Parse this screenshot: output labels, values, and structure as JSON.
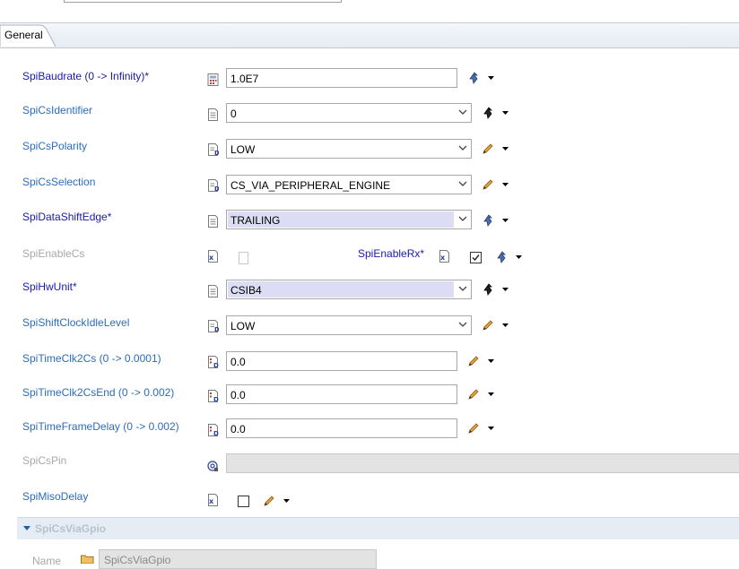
{
  "tab": {
    "label": "General"
  },
  "rows": {
    "baudrate": {
      "label": "SpiBaudrate (0 -> Infinity)*",
      "value": "1.0E7"
    },
    "cs_identifier": {
      "label": "SpiCsIdentifier",
      "value": "0"
    },
    "cs_polarity": {
      "label": "SpiCsPolarity",
      "value": "LOW"
    },
    "cs_selection": {
      "label": "SpiCsSelection",
      "value": "CS_VIA_PERIPHERAL_ENGINE"
    },
    "data_shift_edge": {
      "label": "SpiDataShiftEdge*",
      "value": "TRAILING"
    },
    "enable_cs": {
      "label": "SpiEnableCs",
      "checked": false
    },
    "enable_rx": {
      "label": "SpiEnableRx*",
      "checked": true
    },
    "hw_unit": {
      "label": "SpiHwUnit*",
      "value": "CSIB4"
    },
    "shift_clock_idle": {
      "label": "SpiShiftClockIdleLevel",
      "value": "LOW"
    },
    "time_clk2cs": {
      "label": "SpiTimeClk2Cs (0 -> 0.0001)",
      "value": "0.0"
    },
    "time_clk2cs_end": {
      "label": "SpiTimeClk2CsEnd (0 -> 0.002)",
      "value": "0.0"
    },
    "time_frame_delay": {
      "label": "SpiTimeFrameDelay (0 -> 0.002)",
      "value": "0.0"
    },
    "cs_pin": {
      "label": "SpiCsPin",
      "value": ""
    },
    "miso_delay": {
      "label": "SpiMisoDelay",
      "checked": false
    }
  },
  "section": {
    "title": "SpiCsViaGpio",
    "name_label": "Name",
    "name_value": "SpiCsViaGpio"
  },
  "colors": {
    "required_label": "#1a1aa6",
    "optional_label": "#2a6dbb",
    "disabled_label": "#a8a8a8",
    "highlight": "#dcdcf4"
  }
}
